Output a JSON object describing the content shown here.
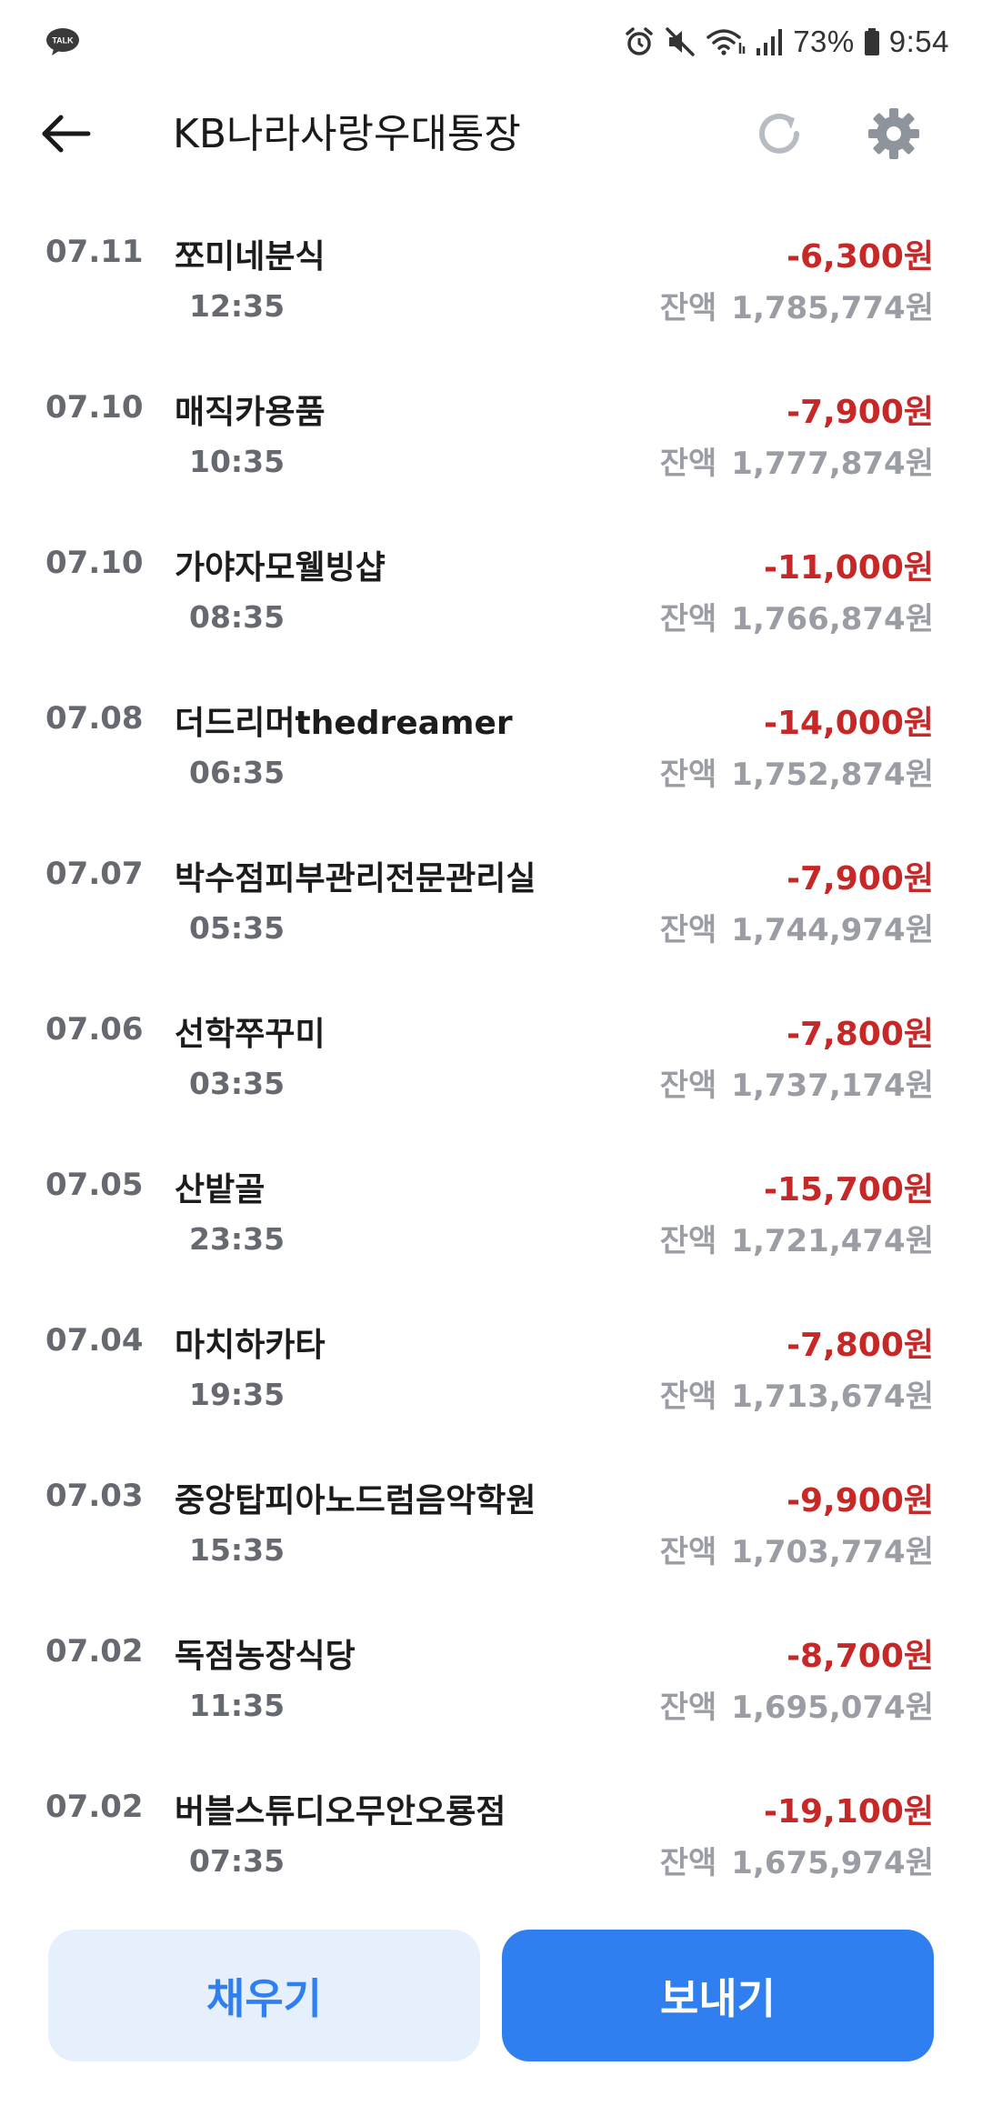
{
  "status_bar": {
    "battery": "73%",
    "time": "9:54",
    "talk_badge": "TALK"
  },
  "header": {
    "title": "KB나라사랑우대통장"
  },
  "transactions": [
    {
      "date": "07.11",
      "merchant": "쪼미네분식",
      "time": "12:35",
      "amount": "-6,300원",
      "balance_label": "잔액",
      "balance": "1,785,774원"
    },
    {
      "date": "07.10",
      "merchant": "매직카용품",
      "time": "10:35",
      "amount": "-7,900원",
      "balance_label": "잔액",
      "balance": "1,777,874원"
    },
    {
      "date": "07.10",
      "merchant": "가야자모웰빙샵",
      "time": "08:35",
      "amount": "-11,000원",
      "balance_label": "잔액",
      "balance": "1,766,874원"
    },
    {
      "date": "07.08",
      "merchant": "더드리머thedreamer",
      "time": "06:35",
      "amount": "-14,000원",
      "balance_label": "잔액",
      "balance": "1,752,874원"
    },
    {
      "date": "07.07",
      "merchant": "박수점피부관리전문관리실",
      "time": "05:35",
      "amount": "-7,900원",
      "balance_label": "잔액",
      "balance": "1,744,974원"
    },
    {
      "date": "07.06",
      "merchant": "선학쭈꾸미",
      "time": "03:35",
      "amount": "-7,800원",
      "balance_label": "잔액",
      "balance": "1,737,174원"
    },
    {
      "date": "07.05",
      "merchant": "산밭골",
      "time": "23:35",
      "amount": "-15,700원",
      "balance_label": "잔액",
      "balance": "1,721,474원"
    },
    {
      "date": "07.04",
      "merchant": "마치하카타",
      "time": "19:35",
      "amount": "-7,800원",
      "balance_label": "잔액",
      "balance": "1,713,674원"
    },
    {
      "date": "07.03",
      "merchant": "중앙탑피아노드럼음악학원",
      "time": "15:35",
      "amount": "-9,900원",
      "balance_label": "잔액",
      "balance": "1,703,774원"
    },
    {
      "date": "07.02",
      "merchant": "독점농장식당",
      "time": "11:35",
      "amount": "-8,700원",
      "balance_label": "잔액",
      "balance": "1,695,074원"
    },
    {
      "date": "07.02",
      "merchant": "버블스튜디오무안오룡점",
      "time": "07:35",
      "amount": "-19,100원",
      "balance_label": "잔액",
      "balance": "1,675,974원"
    }
  ],
  "bottom": {
    "fill_label": "채우기",
    "send_label": "보내기"
  },
  "icons": {
    "back": "arrow-left-icon",
    "refresh": "refresh-icon",
    "settings": "gear-icon"
  },
  "colors": {
    "amount_negative": "#c62828",
    "primary": "#2f7ff0",
    "primary_light": "#e6f0fd"
  }
}
